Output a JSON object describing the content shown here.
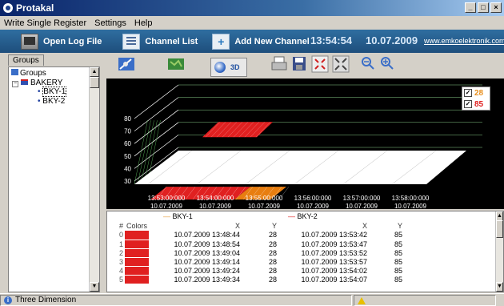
{
  "window": {
    "title": "Protakal",
    "minimize": "_",
    "maximize": "□",
    "close": "×"
  },
  "menu": [
    "Write Single Register",
    "Settings",
    "Help"
  ],
  "toolbar": {
    "open_log": "Open Log File",
    "channel_list": "Channel List",
    "add_channel": "Add New Channel",
    "time": "13:54:54",
    "date": "10.07.2009",
    "url": "www.emkoelektronik.com.tr"
  },
  "tabs": {
    "groups": "Groups"
  },
  "tree": {
    "root": "Groups",
    "group": "BAKERY",
    "items": [
      "BKY-1",
      "BKY-2"
    ]
  },
  "chart_toolbar": {
    "mode_3d": "3D"
  },
  "legend": [
    {
      "label": "28",
      "color": "#e89020",
      "checked": true
    },
    {
      "label": "85",
      "color": "#e02020",
      "checked": true
    }
  ],
  "chart_data": {
    "type": "bar",
    "title": "",
    "yticks": [
      30,
      40,
      50,
      60,
      70,
      80
    ],
    "xticks": [
      {
        "time": "13:53:00:000",
        "date": "10.07.2009"
      },
      {
        "time": "13:54:00:000",
        "date": "10.07.2009"
      },
      {
        "time": "13:55:00:000",
        "date": "10.07.2009"
      },
      {
        "time": "13:56:00:000",
        "date": "10.07.2009"
      },
      {
        "time": "13:57:00:000",
        "date": "10.07.2009"
      },
      {
        "time": "13:58:00:000",
        "date": "10.07.2009"
      }
    ],
    "series": [
      {
        "name": "BKY-1",
        "color": "#e02020",
        "value": 28
      },
      {
        "name": "BKY-2",
        "color": "#e02020",
        "value": 85
      }
    ]
  },
  "table": {
    "series_headers": [
      "BKY-1",
      "BKY-2"
    ],
    "series_colors": [
      "#e8a040",
      "#e02020"
    ],
    "columns": [
      "#",
      "Colors",
      "X",
      "Y",
      "X",
      "Y"
    ],
    "rows": [
      [
        "0",
        "10.07.2009 13:48:44",
        "28",
        "10.07.2009 13:53:42",
        "85"
      ],
      [
        "1",
        "10.07.2009 13:48:54",
        "28",
        "10.07.2009 13:53:47",
        "85"
      ],
      [
        "2",
        "10.07.2009 13:49:04",
        "28",
        "10.07.2009 13:53:52",
        "85"
      ],
      [
        "3",
        "10.07.2009 13:49:14",
        "28",
        "10.07.2009 13:53:57",
        "85"
      ],
      [
        "4",
        "10.07.2009 13:49:24",
        "28",
        "10.07.2009 13:54:02",
        "85"
      ],
      [
        "5",
        "10.07.2009 13:49:34",
        "28",
        "10.07.2009 13:54:07",
        "85"
      ]
    ],
    "row_color": "#e02020"
  },
  "status": {
    "text": "Three Dimension"
  }
}
